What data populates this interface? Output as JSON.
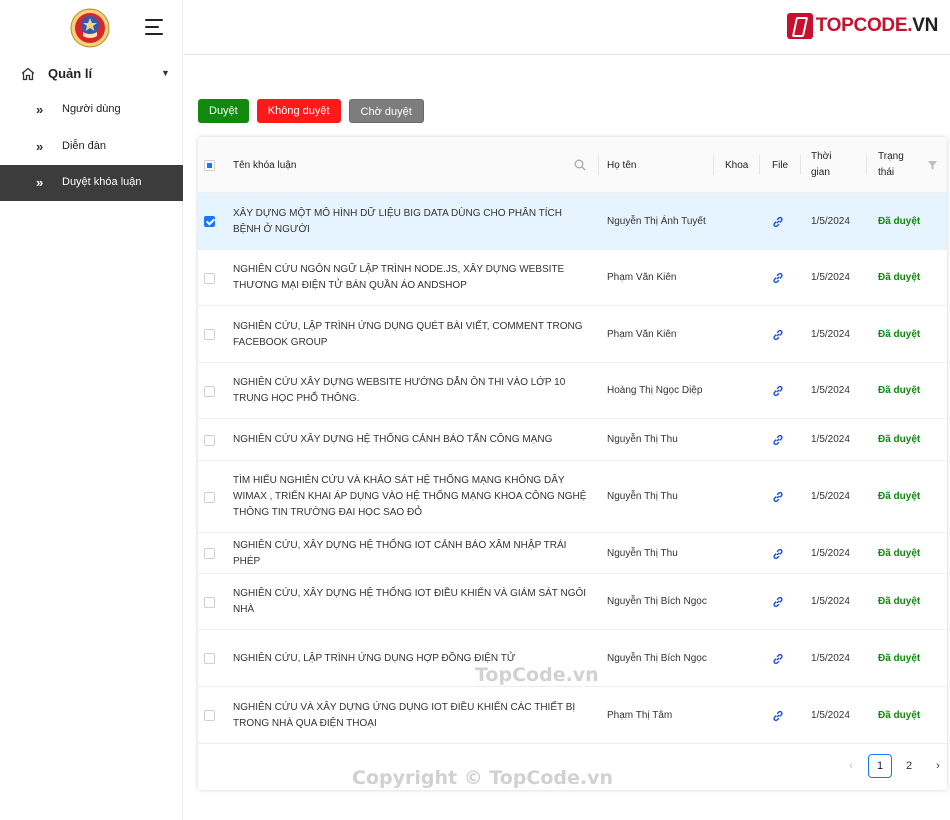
{
  "sidebar": {
    "group_label": "Quản lí",
    "items": [
      {
        "label": "Người dùng",
        "active": false
      },
      {
        "label": "Diễn đàn",
        "active": false
      },
      {
        "label": "Duyệt khóa luận",
        "active": true
      }
    ]
  },
  "header": {
    "brand_accent": "TOPCODE.",
    "brand_dark": "VN",
    "brand_color": "#c8102e"
  },
  "actions": {
    "approve_label": "Duyệt",
    "reject_label": "Không duyệt",
    "pending_label": "Chờ duyệt",
    "approve_color": "#0f8a0f",
    "reject_color": "#ff1a1a",
    "pending_color": "#7d7d7d"
  },
  "table": {
    "columns": {
      "title": "Tên khóa luận",
      "name": "Họ tên",
      "dept": "Khoa",
      "file": "File",
      "time": "Thời gian",
      "status": "Trạng thái"
    },
    "rows": [
      {
        "title": "Xây dựng một mô hình dữ liệu big data dùng cho phân tích bệnh ở người",
        "name": "Nguyễn Thị Ánh Tuyết",
        "date": "1/5/2024",
        "status": "Đã duyệt",
        "selected": true
      },
      {
        "title": "Nghiên cứu ngôn ngữ lập trình Node.js, xây dựng website thương mại điện tử bán quần áo ANDSHOP",
        "name": "Phạm Văn Kiên",
        "date": "1/5/2024",
        "status": "Đã duyệt",
        "selected": false
      },
      {
        "title": "Nghiên cứu, lập trình ứng dụng quét bài viết, comment trong facebook group",
        "name": "Phạm Văn Kiên",
        "date": "1/5/2024",
        "status": "Đã duyệt",
        "selected": false
      },
      {
        "title": "Nghiên cứu xây dựng website hướng dẫn ôn thi vào lớp 10 trung học phổ thông.",
        "name": "Hoàng Thị Ngọc Diệp",
        "date": "1/5/2024",
        "status": "Đã duyệt",
        "selected": false
      },
      {
        "title": "Nghiên cứu xây dựng hệ thống cảnh báo tấn công mạng",
        "name": "Nguyễn Thị Thu",
        "date": "1/5/2024",
        "status": "Đã duyệt",
        "selected": false
      },
      {
        "title": "Tìm hiểu nghiên cứu và khảo sát hệ thống mạng không dây WiMAX , triển khai áp dụng vào hệ thống mạng khoa Công nghệ thông tin trường Đại học Sao Đỏ",
        "name": "Nguyễn Thị Thu",
        "date": "1/5/2024",
        "status": "Đã duyệt",
        "selected": false
      },
      {
        "title": "Nghiên cứu, xây dựng hệ thống IoT cảnh báo xâm nhập trái phép",
        "name": "Nguyễn Thị Thu",
        "date": "1/5/2024",
        "status": "Đã duyệt",
        "selected": false
      },
      {
        "title": "Nghiên cứu, xây dựng hệ thống IoT điều khiển và giám sát ngôi nhà",
        "name": "Nguyễn Thị Bích Ngọc",
        "date": "1/5/2024",
        "status": "Đã duyệt",
        "selected": false
      },
      {
        "title": "Nghiên cứu, lập trình ứng dụng hợp đồng điện tử",
        "name": "Nguyễn Thị Bích Ngọc",
        "date": "1/5/2024",
        "status": "Đã duyệt",
        "selected": false
      },
      {
        "title": "Nghiên cứu và xây dựng ứng dụng IoT điều khiển các thiết bị trong nhà qua điện thoại",
        "name": "Phạm Thị Tâm",
        "date": "1/5/2024",
        "status": "Đã duyệt",
        "selected": false
      }
    ],
    "status_color": "#0f8a0f"
  },
  "pagination": {
    "prev": "‹",
    "pages": [
      "1",
      "2"
    ],
    "current": "1",
    "next": "›"
  },
  "watermarks": {
    "center": "TopCode.vn",
    "bottom": "Copyright © TopCode.vn"
  }
}
